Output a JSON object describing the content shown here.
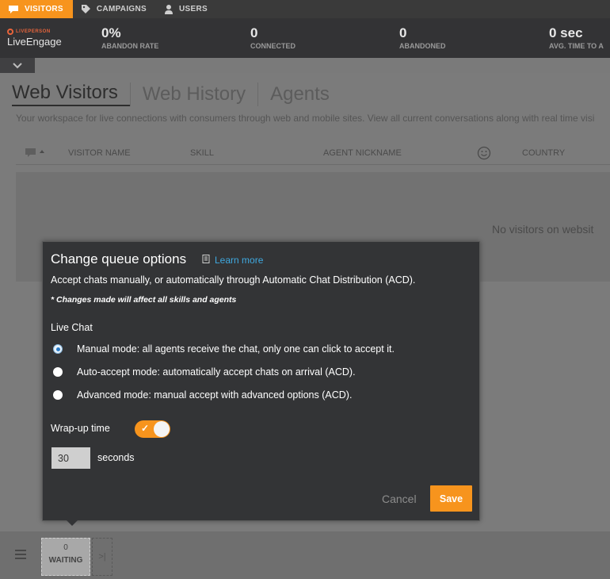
{
  "nav": {
    "tabs": [
      {
        "label": "VISITORS",
        "icon": "chat-bubble-icon",
        "active": true
      },
      {
        "label": "CAMPAIGNS",
        "icon": "tag-icon",
        "active": false
      },
      {
        "label": "USERS",
        "icon": "user-icon",
        "active": false
      }
    ]
  },
  "brand": {
    "small": "LIVEPERSON",
    "name": "LiveEngage"
  },
  "kpis": [
    {
      "value": "0%",
      "label": "ABANDON RATE"
    },
    {
      "value": "0",
      "label": "CONNECTED"
    },
    {
      "value": "0",
      "label": "ABANDONED"
    },
    {
      "value": "0 sec",
      "label": "AVG. TIME TO A"
    }
  ],
  "main": {
    "tabs": [
      "Web Visitors",
      "Web History",
      "Agents"
    ],
    "subtitle": "Your workspace for live connections with consumers through web and mobile sites. View all current conversations along with real time visi",
    "columns": [
      "VISITOR NAME",
      "SKILL",
      "AGENT NICKNAME",
      "COUNTRY"
    ],
    "empty_message": "No visitors on websit"
  },
  "bottom": {
    "waiting_count": "0",
    "waiting_label": "WAITING"
  },
  "modal": {
    "title": "Change queue options",
    "learn_more": "Learn more",
    "description": "Accept chats manually, or automatically through Automatic Chat Distribution (ACD).",
    "note": "* Changes made will affect all skills and agents",
    "section": "Live Chat",
    "options": [
      {
        "label": "Manual mode: all agents receive the chat, only one can click to accept it.",
        "selected": true
      },
      {
        "label": "Auto-accept mode: automatically accept chats on arrival (ACD).",
        "selected": false
      },
      {
        "label": "Advanced mode: manual accept with advanced options (ACD).",
        "selected": false
      }
    ],
    "wrapup_label": "Wrap-up time",
    "wrapup_enabled": true,
    "seconds_value": "30",
    "seconds_label": "seconds",
    "cancel_label": "Cancel",
    "save_label": "Save"
  },
  "colors": {
    "accent": "#f7941d",
    "link": "#3fa9e0",
    "modal_bg": "#333436"
  }
}
